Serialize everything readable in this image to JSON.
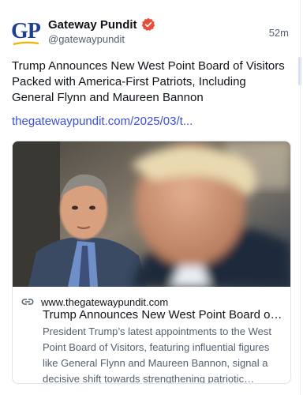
{
  "author": {
    "name": "Gateway Pundit",
    "handle": "@gatewaypundit",
    "avatar_text": "GP",
    "verified_icon": "verified-badge-icon"
  },
  "post": {
    "time": "52m",
    "text": "Trump Announces New West Point Board of Visitors Packed with America-First Patriots, Including General Flynn and Maureen Bannon",
    "link_text": "thegatewaypundit.com/2025/03/t..."
  },
  "link_card": {
    "domain": "www.thegatewaypundit.com",
    "title": "Trump Announces New West Point Board of Visitors Packed with America-First Patriots",
    "description": "President Trump’s latest appointments to the West Point Board of Visitors, featuring influential figures like General Flynn and Maureen Bannon, signal a decisive shift towards strengthening patriotic leadership in the...",
    "image_icon": "news-photo"
  },
  "colors": {
    "link": "#3b4fd1",
    "brand_blue": "#1d3f8f",
    "verified": "#e94d3c",
    "muted_text": "#55606e"
  }
}
